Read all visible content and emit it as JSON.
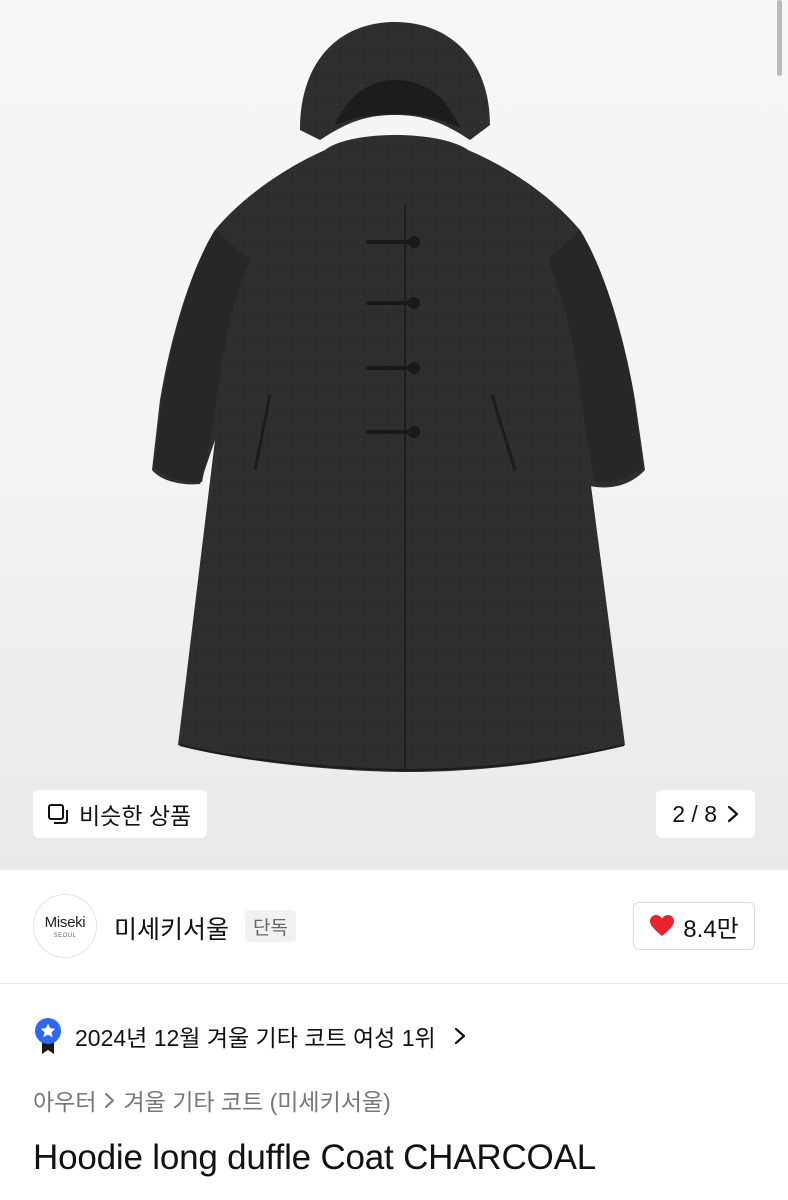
{
  "gallery": {
    "similar_label": "비슷한 상품",
    "pager_text": "2 / 8",
    "image_subject": "charcoal hooded long duffle coat"
  },
  "brand": {
    "logo_line1": "Miseki",
    "logo_line2": "SEOUL",
    "name": "미세키서울",
    "badge": "단독"
  },
  "likes": {
    "count": "8.4만",
    "heart_color": "#e8232f"
  },
  "ranking": {
    "text": "2024년 12월 겨울 기타 코트 여성 1위",
    "medal_color": "#2f66f2"
  },
  "breadcrumb": {
    "parent": "아우터",
    "child": "겨울 기타 코트 (미세키서울)"
  },
  "product": {
    "title": "Hoodie long duffle Coat CHARCOAL"
  }
}
